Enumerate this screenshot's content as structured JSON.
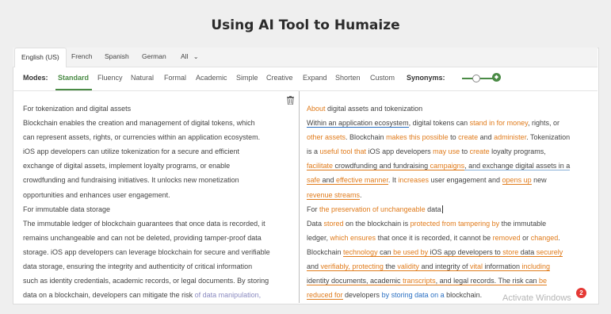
{
  "page_title": "Using AI Tool to Humaize",
  "languages": [
    "English (US)",
    "French",
    "Spanish",
    "German",
    "All"
  ],
  "modes_label": "Modes:",
  "modes": [
    "Standard",
    "Fluency",
    "Natural",
    "Formal",
    "Academic",
    "Simple",
    "Creative",
    "Expand",
    "Shorten",
    "Custom"
  ],
  "synonyms_label": "Synonyms:",
  "watermark": "Activate Windows",
  "notification_count": "2",
  "icons": {
    "delete": "trash-icon",
    "dropdown": "chevron-down-icon",
    "premium": "diamond-icon"
  },
  "colors": {
    "accent": "#4a8b45",
    "changed": "#e07b1b",
    "structural": "#2a6fc2",
    "badge": "#e53935"
  },
  "input_text": {
    "line1": "For tokenization and digital assets",
    "line2": "Blockchain enables the creation and management of digital tokens, which",
    "line3": "can represent assets, rights, or currencies within an application ecosystem.",
    "line4": "iOS app developers can utilize tokenization for a secure and efficient",
    "line5": "exchange of digital assets, implement loyalty programs, or enable",
    "line6": "crowdfunding and fundraising initiatives. It unlocks new monetization",
    "line7": "opportunities and enhances user engagement.",
    "line8": "For immutable data storage",
    "line9": "The immutable ledger of blockchain guarantees that once data is recorded, it",
    "line10": "remains unchangeable and can not be deleted, providing tamper-proof data",
    "line11": "storage. iOS app developers can leverage blockchain for secure and verifiable",
    "line12": "data storage, ensuring the integrity and authenticity of critical information",
    "line13": "such as identity credentials, academic records, or legal documents. By storing",
    "line14a": "data on a blockchain, developers can mitigate the risk ",
    "line14b": "of data manipulation,"
  },
  "output_text": {
    "r1": [
      "About",
      " digital assets and tokenization"
    ],
    "r2": [
      "Within an application ecosystem",
      ", digital tokens can ",
      "stand in",
      " ",
      "for money",
      ", rights, or"
    ],
    "r3": [
      "other assets",
      ". Blockchain ",
      "makes this possible",
      " to ",
      "create",
      " and ",
      "administer",
      ". Tokenization"
    ],
    "r4": [
      "is a ",
      "useful tool that",
      " iOS app developers ",
      "may use",
      " to ",
      "create",
      " loyalty programs,"
    ],
    "r5": [
      "facilitate",
      " crowdfunding and fundraising ",
      "campaigns",
      ", and exchange digital assets in a"
    ],
    "r6": [
      "safe",
      " and ",
      "effective manner",
      ". It ",
      "increases",
      " user engagement and ",
      "opens up",
      " new"
    ],
    "r7": [
      "revenue streams",
      "."
    ],
    "r8": [
      "For ",
      "the preservation of unchangeable",
      " data"
    ],
    "r9": [
      "Data ",
      "stored",
      " on the blockchain is ",
      "protected from tampering by",
      " the immutable"
    ],
    "r10": [
      "ledger, ",
      "which ensures",
      " that once it is recorded, it cannot be ",
      "removed",
      " or ",
      "changed",
      "."
    ],
    "r11": [
      "Blockchain ",
      "technology",
      " can ",
      "be used by",
      " iOS app developers to ",
      "store",
      " data ",
      "securely"
    ],
    "r12": [
      "and ",
      "verifiably, protecting",
      " the ",
      "validity",
      " and integrity of ",
      "vital",
      " information ",
      "including"
    ],
    "r13": [
      "identity documents, academic ",
      "transcripts",
      ", and legal records. The risk can ",
      "be"
    ],
    "r14": [
      "reduced for",
      " developers ",
      "by storing data on a",
      " blockchain."
    ]
  }
}
